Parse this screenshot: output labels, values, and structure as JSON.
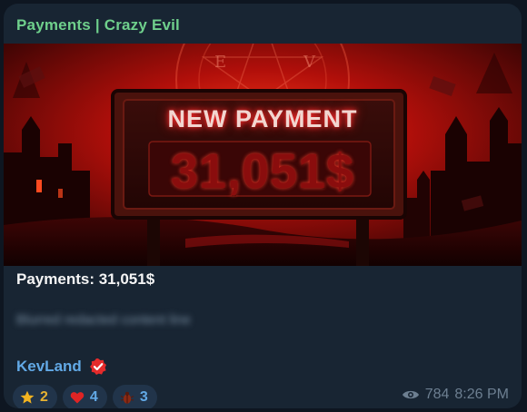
{
  "channel": {
    "title": "Payments | Crazy Evil"
  },
  "media": {
    "headline": "NEW PAYMENT",
    "amount": "31,051$",
    "seal_letters": [
      "E",
      "V"
    ]
  },
  "message": {
    "caption": "Payments: 31,051$",
    "blurred_text": "Blurred redacted content line",
    "signature": "KevLand",
    "signature_badge_icon": "verified-badge-icon"
  },
  "reactions": [
    {
      "icon": "star-icon",
      "count": "2"
    },
    {
      "icon": "red-heart-icon",
      "count": "4"
    },
    {
      "icon": "beetle-icon",
      "count": "3"
    }
  ],
  "meta": {
    "views": "784",
    "time": "8:26 PM"
  },
  "colors": {
    "background": "#0e1621",
    "bubble": "#182533",
    "title": "#6fd08c",
    "link": "#62a9e6",
    "meta": "#6d7f91"
  }
}
